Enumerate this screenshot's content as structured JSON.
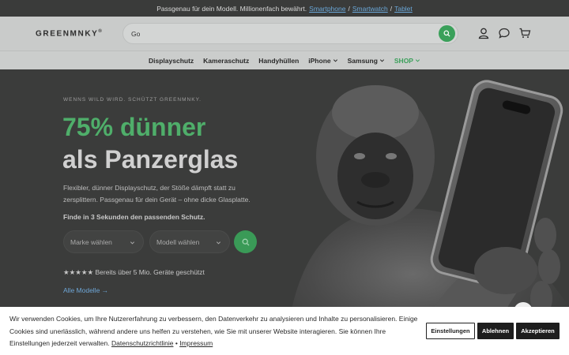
{
  "topbar": {
    "text": "Passgenau für dein Modell. Millionenfach bewährt.",
    "links": [
      "Smartphone",
      "Smartwatch",
      "Tablet"
    ],
    "separator": "/"
  },
  "header": {
    "logo": "GREENMNKY",
    "logo_mark": "®",
    "search_value": "Go"
  },
  "nav": {
    "items": [
      {
        "label": "Displayschutz",
        "dropdown": false
      },
      {
        "label": "Kameraschutz",
        "dropdown": false
      },
      {
        "label": "Handyhüllen",
        "dropdown": false
      },
      {
        "label": "iPhone",
        "dropdown": true
      },
      {
        "label": "Samsung",
        "dropdown": true
      },
      {
        "label": "SHOP",
        "dropdown": true
      }
    ]
  },
  "hero": {
    "eyebrow": "WENNS WILD WIRD. SCHÜTZT GREENMNKY.",
    "headline_accent": "75% dünner",
    "headline_main": "als Panzerglas",
    "description": "Flexibler, dünner Displayschutz, der Stöße dämpft statt zu zersplittern. Passgenau für dein Gerät – ohne dicke Glasplatte.",
    "finder_label": "Finde in 3 Sekunden den passenden Schutz.",
    "brand_select": "Marke wählen",
    "model_select": "Modell wählen",
    "rating": "★★★★★ Bereits über 5 Mio. Geräte geschützt",
    "all_models": "Alle Modelle →"
  },
  "cookie": {
    "text": "Wir verwenden Cookies, um Ihre Nutzererfahrung zu verbessern, den Datenverkehr zu analysieren und Inhalte zu personalisieren. Einige Cookies sind unerlässlich, während andere uns helfen zu verstehen, wie Sie mit unserer Website interagieren. Sie können Ihre Einstellungen jederzeit verwalten.",
    "privacy_link": "Datenschutzrichtlinie",
    "link_separator": "•",
    "imprint_link": "Impressum",
    "settings_button": "Einstellungen",
    "reject_button": "Ablehnen",
    "accept_button": "Akzeptieren"
  },
  "colors": {
    "accent_green": "#3aa05a",
    "link_blue": "#6aa7d8",
    "hero_bg": "#3b3c3b"
  },
  "icons": [
    "search-icon",
    "user-icon",
    "chat-icon",
    "cart-icon",
    "chevron-down-icon",
    "arrow-right-icon"
  ]
}
